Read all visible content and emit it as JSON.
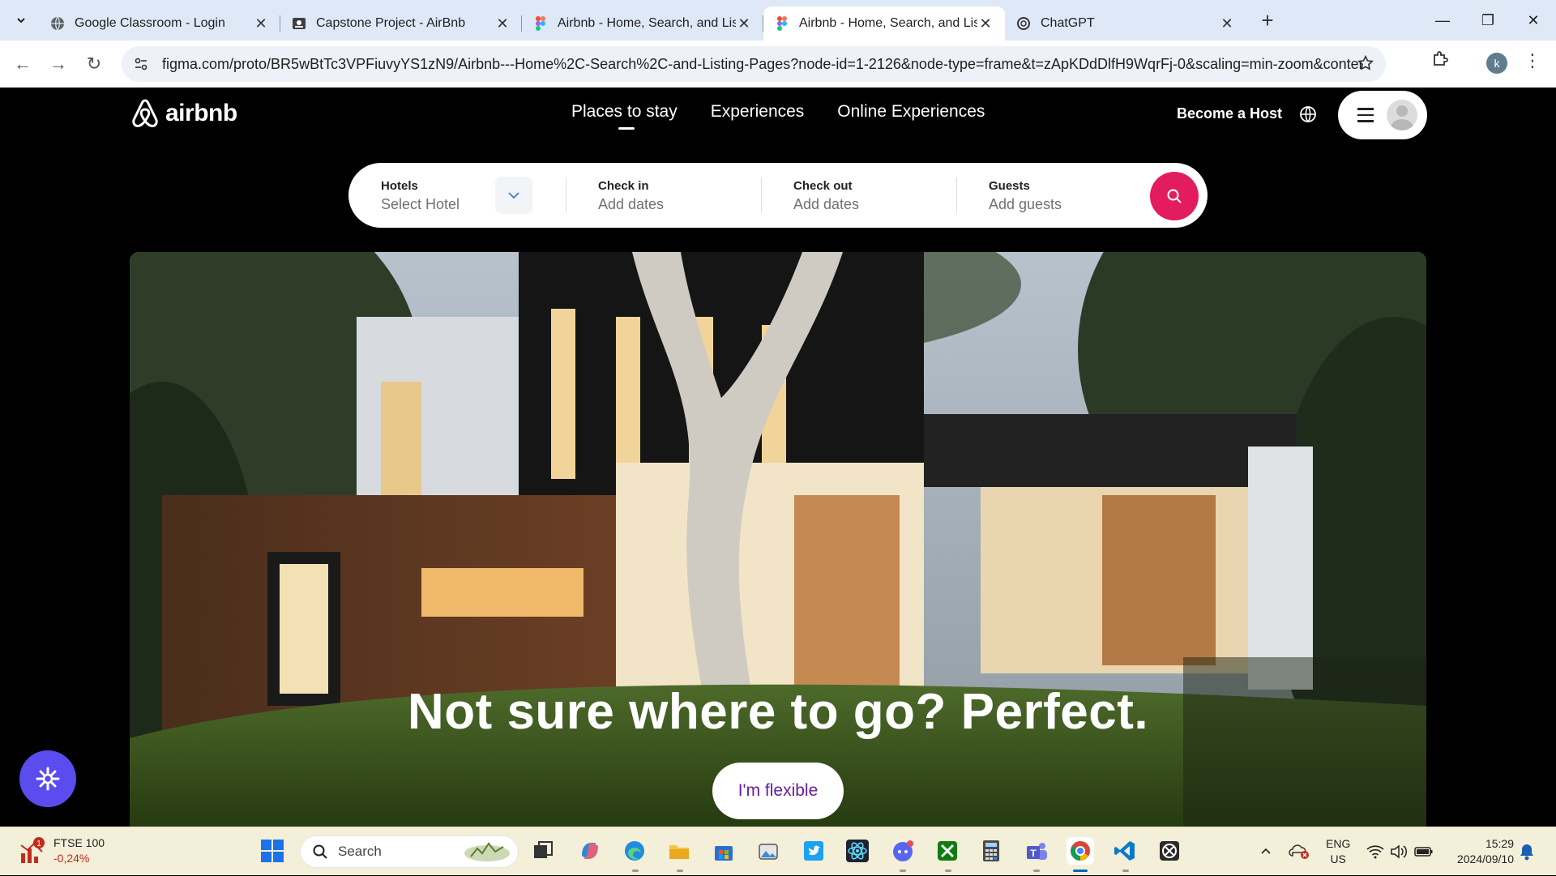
{
  "browser": {
    "tabs": [
      {
        "title": "Google Classroom - Login",
        "active": false
      },
      {
        "title": "Capstone Project - AirBnb",
        "active": false
      },
      {
        "title": "Airbnb - Home, Search, and Listing Pages",
        "active": false
      },
      {
        "title": "Airbnb - Home, Search, and Listing Pages",
        "active": true
      },
      {
        "title": "ChatGPT",
        "active": false
      }
    ],
    "url": "figma.com/proto/BR5wBtTc3VPFiuvyYS1zN9/Airbnb---Home%2C-Search%2C-and-Listing-Pages?node-id=1-2126&node-type=frame&t=zApKDdDlfH9WqrFj-0&scaling=min-zoom&content-sc...",
    "profile_initial": "k"
  },
  "airbnb": {
    "logo_text": "airbnb",
    "nav": [
      "Places to stay",
      "Experiences",
      "Online Experiences"
    ],
    "become_host": "Become a Host",
    "search": {
      "hotels_label": "Hotels",
      "hotels_value": "Select Hotel",
      "checkin_label": "Check in",
      "checkin_value": "Add dates",
      "checkout_label": "Check out",
      "checkout_value": "Add dates",
      "guests_label": "Guests",
      "guests_value": "Add guests"
    },
    "hero_title": "Not sure where to go? Perfect.",
    "flexible_button": "I'm flexible",
    "accent_color": "#e31c5f"
  },
  "taskbar": {
    "widget_title": "FTSE 100",
    "widget_change": "-0,24%",
    "widget_badge": "1",
    "search_text": "Search",
    "lang_1": "ENG",
    "lang_2": "US",
    "time": "15:29",
    "date": "2024/09/10"
  }
}
